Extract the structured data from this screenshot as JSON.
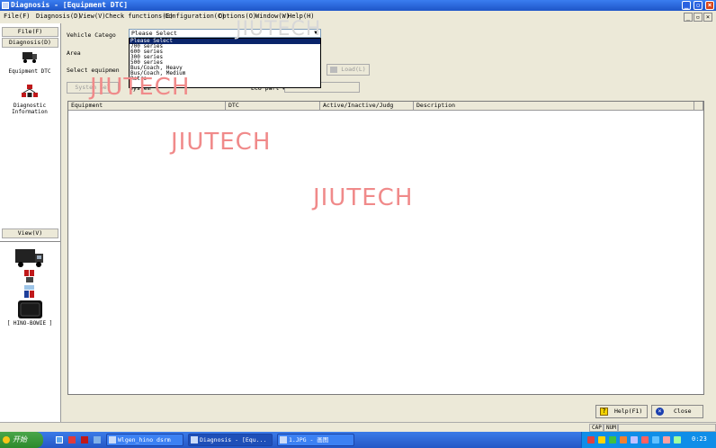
{
  "window": {
    "title": "Diagnosis - [Equipment DTC]"
  },
  "menu": [
    {
      "label": "File(F)"
    },
    {
      "label": "Diagnosis(D)"
    },
    {
      "label": "View(V)"
    },
    {
      "label": "Check functions(E)"
    },
    {
      "label": "Configuration(C)"
    },
    {
      "label": "Options(O)"
    },
    {
      "label": "Window(W)"
    },
    {
      "label": "Help(H)"
    }
  ],
  "left_panel": {
    "file_header": "File(F)",
    "diagnosis_header": "Diagnosis(D)",
    "equipment_dtc_label": "Equipment DTC",
    "diagnostic_information_label": "Diagnostic Information",
    "view_header": "View(V)",
    "hino_bowie_label": "[ HINO-BOWIE ]"
  },
  "form": {
    "vehicle_category_label": "Vehicle Catego",
    "vehicle_category_value": "Please Select",
    "area_label": "Area",
    "select_equipment_label": "Select equipmen",
    "load_button": "Load(L)",
    "system_button": "System Sel",
    "system_label": "System",
    "ecu_part_label": "ECU part #"
  },
  "dropdown": {
    "options": [
      "Please Select",
      "700 series",
      "600 series",
      "300 series",
      "500 series",
      "Bus/Coach, Heavy",
      "Bus/Coach, Medium",
      "Retro"
    ],
    "selected_index": 0
  },
  "table": {
    "columns": [
      "Equipment",
      "DTC",
      "Active/Inactive/Judg",
      "Description"
    ],
    "rows": []
  },
  "buttons": {
    "help": "Help(F1)",
    "close": "Close"
  },
  "status_bar": {
    "cells": [
      "CAP",
      "NUM"
    ]
  },
  "taskbar": {
    "start_label": "开始",
    "tasks": [
      {
        "label": "Wlgen_hino dsrm"
      },
      {
        "label": "Diagnosis - [Equ..."
      },
      {
        "label": "1.JPG - 画图"
      }
    ],
    "clock": "0:23"
  },
  "watermark": {
    "text": "JIUTECH",
    "color": "#f08a8a"
  },
  "colors": {
    "title_bar": "#1e55c8",
    "selection": "#0a246a",
    "taskbar": "#2457c6",
    "start_button": "#2c8a2c"
  }
}
